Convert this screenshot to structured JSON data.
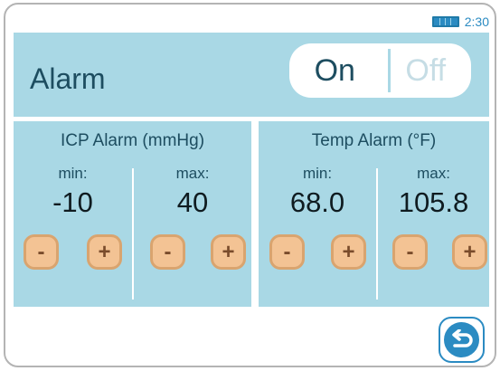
{
  "status": {
    "time": "2:30",
    "battery_icon": "battery-full-icon"
  },
  "alarm": {
    "title": "Alarm",
    "toggle": {
      "on_label": "On",
      "off_label": "Off",
      "selected": "On"
    }
  },
  "icp": {
    "title": "ICP Alarm (mmHg)",
    "min": {
      "label": "min:",
      "value": "-10"
    },
    "max": {
      "label": "max:",
      "value": "40"
    }
  },
  "temp": {
    "title": "Temp Alarm (°F)",
    "min": {
      "label": "min:",
      "value": "68.0"
    },
    "max": {
      "label": "max:",
      "value": "105.8"
    }
  },
  "buttons": {
    "minus": "-",
    "plus": "+"
  },
  "nav": {
    "back_icon": "return-arrow-icon"
  },
  "colors": {
    "panel": "#a9d8e5",
    "accent_blue": "#2b8bc2",
    "button_fill": "#f3c394",
    "button_border": "#d9a46f"
  }
}
